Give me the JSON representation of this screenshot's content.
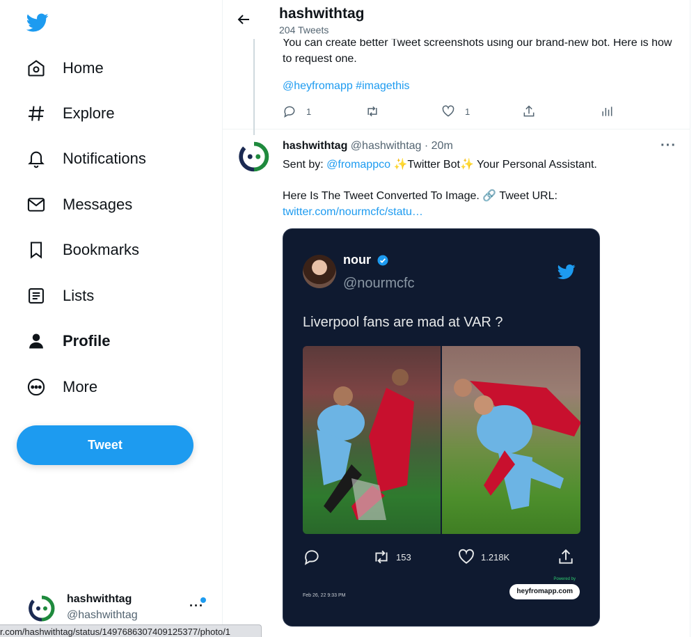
{
  "sidebar": {
    "logo": "twitter-bird-icon",
    "nav": [
      {
        "label": "Home",
        "icon": "home-icon"
      },
      {
        "label": "Explore",
        "icon": "hashtag-icon"
      },
      {
        "label": "Notifications",
        "icon": "bell-icon"
      },
      {
        "label": "Messages",
        "icon": "envelope-icon"
      },
      {
        "label": "Bookmarks",
        "icon": "bookmark-icon"
      },
      {
        "label": "Lists",
        "icon": "list-icon"
      },
      {
        "label": "Profile",
        "icon": "person-icon",
        "active": true
      },
      {
        "label": "More",
        "icon": "more-circle-icon"
      }
    ],
    "tweet_button": "Tweet",
    "account": {
      "name": "hashwithtag",
      "handle": "@hashwithtag",
      "more": "···"
    }
  },
  "status_url": "r.com/hashwithtag/status/1497686307409125377/photo/1",
  "header": {
    "title": "hashwithtag",
    "subtitle": "204 Tweets"
  },
  "previous_tweet": {
    "text": "You can create better Tweet screenshots using our brand-new bot. Here is how to request one.",
    "tags": "@heyfromapp #imagethis",
    "replies": "1",
    "likes": "1"
  },
  "tweet": {
    "name": "hashwithtag",
    "handle": "@hashwithtag",
    "separator": " · ",
    "time": "20m",
    "more": "···",
    "line1_prefix": "Sent by: ",
    "line1_mention": "@fromappco",
    "line1_rest": " ✨Twitter Bot✨ Your Personal Assistant.",
    "line2": "Here Is The Tweet Converted To Image. 🔗 Tweet URL:",
    "link": "twitter.com/nourmcfc/statu…"
  },
  "card": {
    "name": "nour",
    "handle": "@nourmcfc",
    "text": "Liverpool fans are mad at VAR ?",
    "retweets": "153",
    "likes": "1.218K",
    "date": "Feb 26, 22 9:33 PM",
    "powered": "Powered by",
    "brand": "heyfromapp.com"
  },
  "colors": {
    "accent": "#1d9bf0",
    "card_bg": "#0f1a30",
    "brand_green": "#2ecc71"
  }
}
